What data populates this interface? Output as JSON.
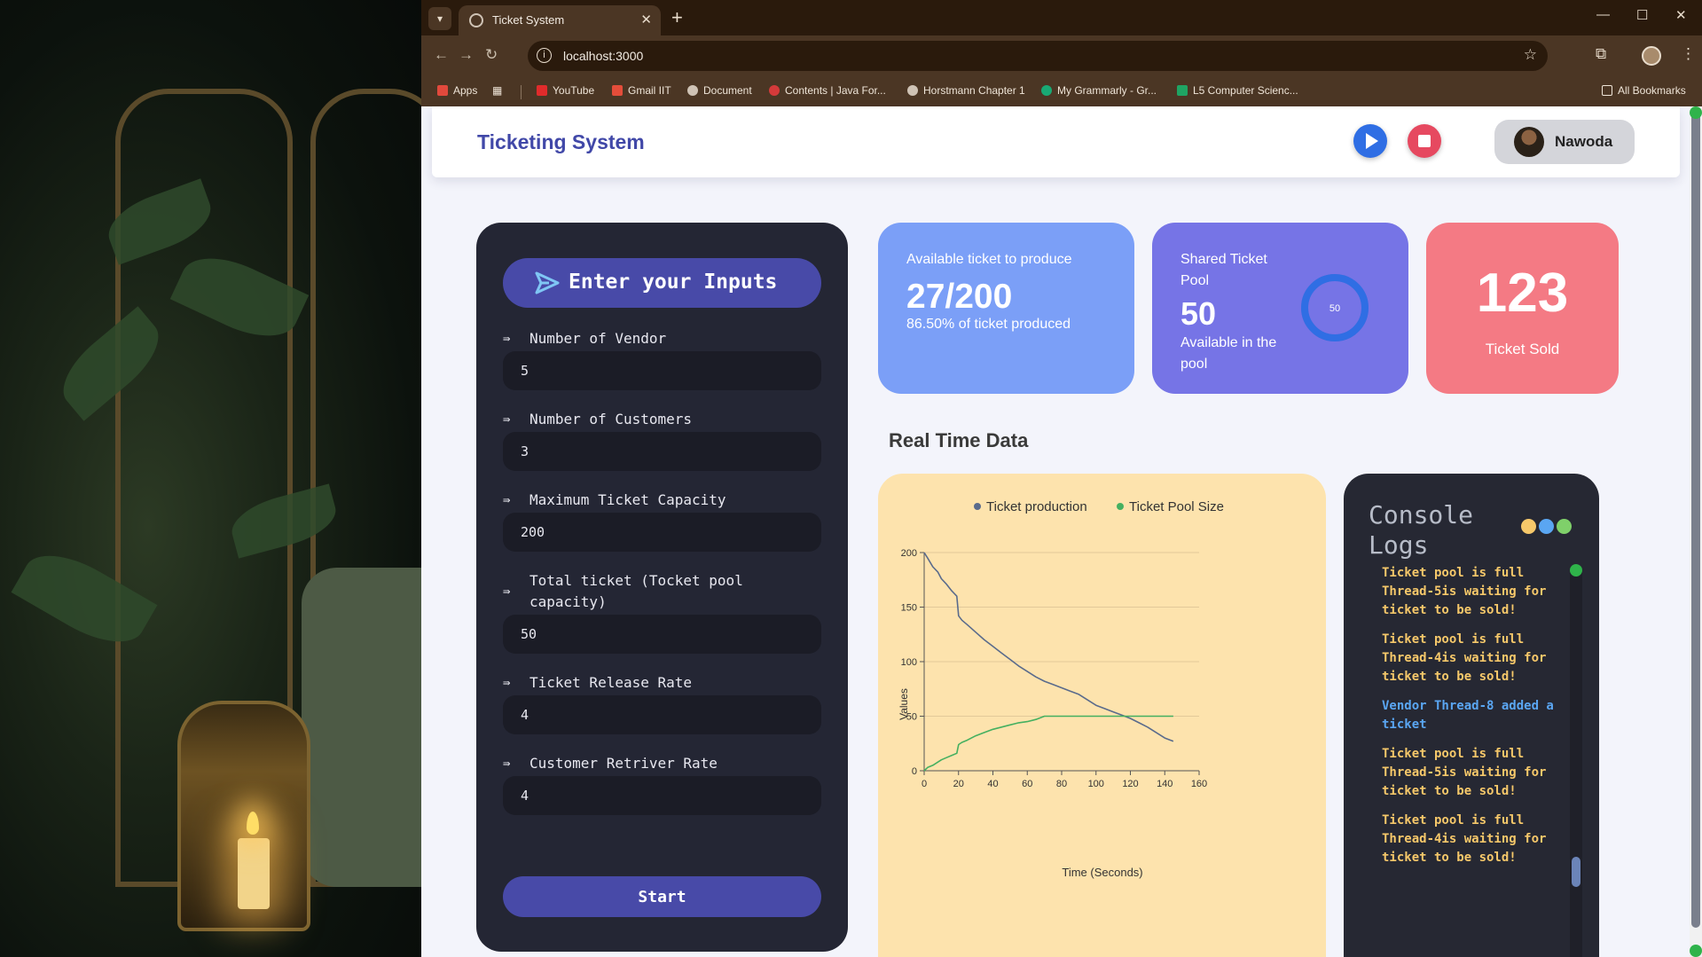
{
  "browser": {
    "tab_title": "Ticket System",
    "url": "localhost:3000",
    "bookmarks": [
      {
        "label": "Apps",
        "color": "#e1493c"
      },
      {
        "label": "YouTube",
        "color": "#e02b2b"
      },
      {
        "label": "Gmail IIT",
        "color": "#e44d3a"
      },
      {
        "label": "Document",
        "color": "#cfc3b5"
      },
      {
        "label": "Contents | Java For...",
        "color": "#d43a3a"
      },
      {
        "label": "Horstmann Chapter 1",
        "color": "#cfc3b5"
      },
      {
        "label": "My Grammarly - Gr...",
        "color": "#19a974"
      },
      {
        "label": "L5 Computer Scienc...",
        "color": "#1fa463"
      }
    ],
    "all_bookmarks": "All Bookmarks"
  },
  "navbar": {
    "brand": "Ticketing System",
    "user_name": "Nawoda",
    "play_icon": "play-icon",
    "stop_icon": "stop-icon"
  },
  "inputs": {
    "title": "Enter your Inputs",
    "fields": [
      {
        "label": "Number of Vendor",
        "value": "5"
      },
      {
        "label": "Number of Customers",
        "value": "3"
      },
      {
        "label": "Maximum Ticket Capacity",
        "value": "200"
      },
      {
        "label": "Total ticket (Tocket pool capacity)",
        "value": "50"
      },
      {
        "label": "Ticket Release Rate",
        "value": "4"
      },
      {
        "label": "Customer Retriver Rate",
        "value": "4"
      }
    ],
    "start_label": "Start"
  },
  "cards": {
    "available": {
      "label": "Available ticket to produce",
      "value": "27/200",
      "sub": "86.50% of ticket produced"
    },
    "pool": {
      "label": "Shared Ticket Pool",
      "value": "50",
      "sub": "Available in the pool",
      "donut_value": "50",
      "donut_fraction": 1.0
    },
    "sold": {
      "value": "123",
      "label": "Ticket Sold"
    }
  },
  "section_title": "Real Time Data",
  "colors": {
    "production": "#5a6b8c",
    "pool": "#45b060",
    "accent": "#484aa8"
  },
  "chart_data": {
    "type": "line",
    "xlabel": "Time (Seconds)",
    "ylabel": "Values",
    "xlim": [
      0,
      160
    ],
    "ylim": [
      0,
      200
    ],
    "xticks": [
      0,
      20,
      40,
      60,
      80,
      100,
      120,
      140,
      160
    ],
    "yticks": [
      0,
      50,
      100,
      150,
      200
    ],
    "legend": "top",
    "grid": "horizontal",
    "series": [
      {
        "name": "Ticket production",
        "x": [
          0,
          2,
          5,
          8,
          10,
          13,
          16,
          19,
          20,
          22,
          25,
          30,
          35,
          40,
          45,
          50,
          55,
          60,
          65,
          70,
          75,
          80,
          85,
          90,
          95,
          100,
          105,
          110,
          115,
          120,
          125,
          130,
          135,
          140,
          145
        ],
        "y": [
          200,
          195,
          187,
          182,
          176,
          171,
          165,
          160,
          142,
          138,
          134,
          127,
          120,
          114,
          108,
          102,
          96,
          91,
          86,
          82,
          79,
          76,
          73,
          70,
          65,
          60,
          57,
          54,
          51,
          48,
          44,
          40,
          35,
          30,
          27
        ]
      },
      {
        "name": "Ticket Pool Size",
        "x": [
          0,
          2,
          5,
          8,
          10,
          13,
          16,
          19,
          20,
          22,
          25,
          30,
          35,
          40,
          45,
          50,
          55,
          60,
          65,
          70,
          75,
          80,
          85,
          90,
          95,
          100,
          105,
          110,
          115,
          120,
          125,
          130,
          135,
          140,
          145
        ],
        "y": [
          0,
          3,
          5,
          8,
          10,
          12,
          14,
          16,
          24,
          26,
          28,
          32,
          35,
          38,
          40,
          42,
          44,
          45,
          47,
          50,
          50,
          50,
          50,
          50,
          50,
          50,
          50,
          50,
          50,
          50,
          50,
          50,
          50,
          50,
          50
        ]
      }
    ]
  },
  "console": {
    "title": "Console Logs",
    "dots": [
      "#f6c86a",
      "#5aa6f2",
      "#7fd06a"
    ],
    "logs": [
      {
        "type": "warn",
        "text": "Ticket pool is full Thread-5is waiting for ticket to be sold!"
      },
      {
        "type": "warn",
        "text": "Ticket pool is full Thread-4is waiting for ticket to be sold!"
      },
      {
        "type": "info",
        "text": "Vendor Thread-8 added a ticket"
      },
      {
        "type": "warn",
        "text": "Ticket pool is full Thread-5is waiting for ticket to be sold!"
      },
      {
        "type": "warn",
        "text": "Ticket pool is full Thread-4is waiting for ticket to be sold!"
      }
    ]
  }
}
